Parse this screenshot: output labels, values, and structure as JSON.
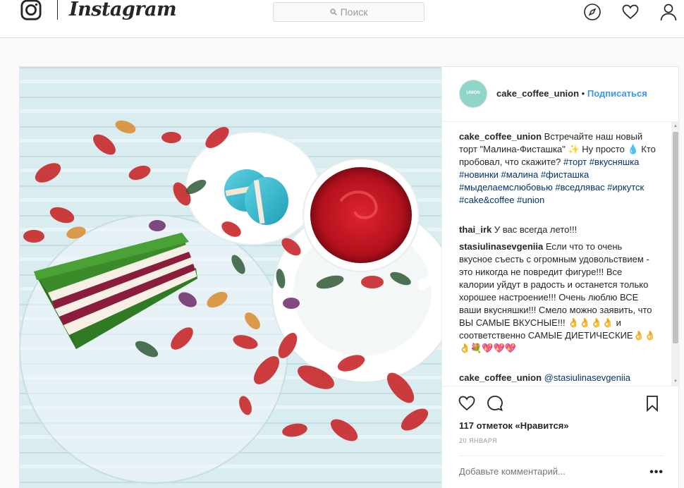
{
  "nav": {
    "wordmark": "Instagram",
    "search_placeholder": "Поиск",
    "icons": [
      "instagram-glyph-icon",
      "compass-icon",
      "heart-icon",
      "user-icon"
    ]
  },
  "post": {
    "username": "cake_coffee_union",
    "separator": "•",
    "follow_label": "Подписаться",
    "avatar_text": "UNION",
    "caption": {
      "user": "cake_coffee_union",
      "text": "Встречайте наш новый торт \"Малина-Фисташка\" ✨ Ну просто 💧 Кто пробовал, что скажите? ",
      "tags": "#торт #вкусняшка #новинки #малина #фисташка #мыделаемслюбовью #вседлявас #иркутск #cake&coffee #union"
    },
    "comments": [
      {
        "user": "thai_irk",
        "text": "У вас всегда лето!!!"
      },
      {
        "user": "stasiulinasevgeniia",
        "text": "Если что то очень вкусное съесть с огромным удовольствием - это никогда не повредит фигуре!!! Все калории уйдут в радость и останется только хорошее настроение!!! Очень люблю ВСЕ ваши вкусняшки!!! Смело можно заявить, что ВЫ САМЫЕ ВКУСНЫЕ!!! 👌👌👌👌 и соответственно САМЫЕ ДИЕТИЧЕСКИЕ👌👌👌💐💖💖💖"
      },
      {
        "user": "cake_coffee_union",
        "text": "@stasiulinasevgeniia"
      }
    ],
    "likes": "117 отметок «Нравится»",
    "date": "20 ЯНВАРЯ",
    "add_comment_placeholder": "Добавьте комментарий...",
    "more_label": "•••",
    "colors": {
      "link": "#003569",
      "follow": "#3897f0",
      "border": "#dbdbdb"
    }
  }
}
